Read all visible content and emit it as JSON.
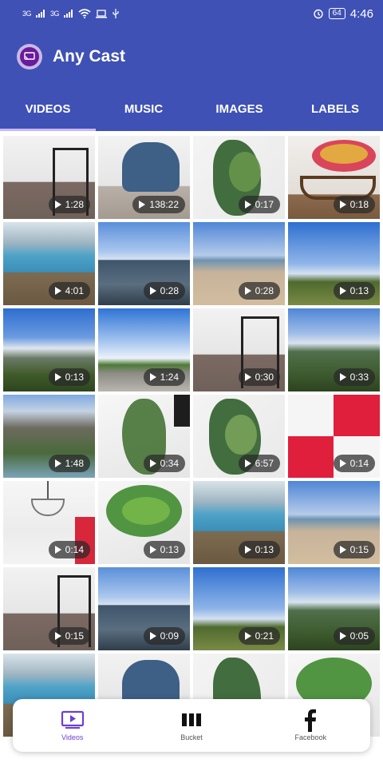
{
  "status_bar": {
    "network_1": "3G",
    "network_2": "3G",
    "battery": "64",
    "time": "4:46"
  },
  "app_bar": {
    "title": "Any Cast"
  },
  "tabs": [
    {
      "label": "VIDEOS",
      "active": true
    },
    {
      "label": "MUSIC",
      "active": false
    },
    {
      "label": "IMAGES",
      "active": false
    },
    {
      "label": "LABELS",
      "active": false
    }
  ],
  "videos": [
    {
      "duration": "1:28"
    },
    {
      "duration": "138:22"
    },
    {
      "duration": "0:17"
    },
    {
      "duration": "0:18"
    },
    {
      "duration": "4:01"
    },
    {
      "duration": "0:28"
    },
    {
      "duration": "0:28"
    },
    {
      "duration": "0:13"
    },
    {
      "duration": "0:13"
    },
    {
      "duration": "1:24"
    },
    {
      "duration": "0:30"
    },
    {
      "duration": "0:33"
    },
    {
      "duration": "1:48"
    },
    {
      "duration": "0:34"
    },
    {
      "duration": "6:57"
    },
    {
      "duration": "0:14"
    },
    {
      "duration": "0:14"
    },
    {
      "duration": "0:13"
    },
    {
      "duration": "0:13"
    },
    {
      "duration": "0:15"
    },
    {
      "duration": "0:15"
    },
    {
      "duration": "0:09"
    },
    {
      "duration": "0:21"
    },
    {
      "duration": "0:05"
    }
  ],
  "bottom_nav": {
    "items": [
      {
        "label": "Videos",
        "icon": "video-icon",
        "active": true
      },
      {
        "label": "Bucket",
        "icon": "bucket-icon",
        "active": false
      },
      {
        "label": "Facebook",
        "icon": "facebook-icon",
        "active": false
      }
    ]
  },
  "colors": {
    "primary": "#3f51b5",
    "accent": "#6c3fd6"
  }
}
